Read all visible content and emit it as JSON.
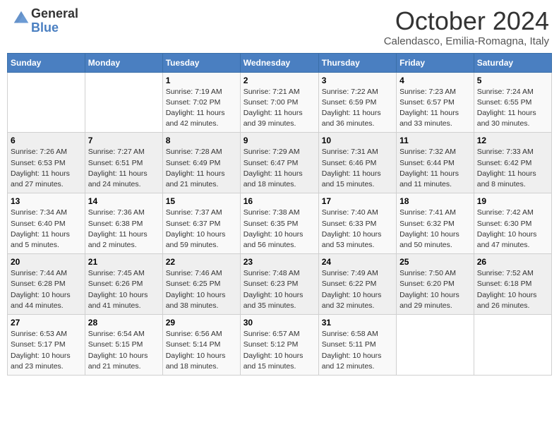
{
  "logo": {
    "general": "General",
    "blue": "Blue"
  },
  "title": "October 2024",
  "subtitle": "Calendasco, Emilia-Romagna, Italy",
  "weekdays": [
    "Sunday",
    "Monday",
    "Tuesday",
    "Wednesday",
    "Thursday",
    "Friday",
    "Saturday"
  ],
  "weeks": [
    [
      {
        "day": null,
        "info": null
      },
      {
        "day": null,
        "info": null
      },
      {
        "day": "1",
        "sunrise": "Sunrise: 7:19 AM",
        "sunset": "Sunset: 7:02 PM",
        "daylight": "Daylight: 11 hours and 42 minutes."
      },
      {
        "day": "2",
        "sunrise": "Sunrise: 7:21 AM",
        "sunset": "Sunset: 7:00 PM",
        "daylight": "Daylight: 11 hours and 39 minutes."
      },
      {
        "day": "3",
        "sunrise": "Sunrise: 7:22 AM",
        "sunset": "Sunset: 6:59 PM",
        "daylight": "Daylight: 11 hours and 36 minutes."
      },
      {
        "day": "4",
        "sunrise": "Sunrise: 7:23 AM",
        "sunset": "Sunset: 6:57 PM",
        "daylight": "Daylight: 11 hours and 33 minutes."
      },
      {
        "day": "5",
        "sunrise": "Sunrise: 7:24 AM",
        "sunset": "Sunset: 6:55 PM",
        "daylight": "Daylight: 11 hours and 30 minutes."
      }
    ],
    [
      {
        "day": "6",
        "sunrise": "Sunrise: 7:26 AM",
        "sunset": "Sunset: 6:53 PM",
        "daylight": "Daylight: 11 hours and 27 minutes."
      },
      {
        "day": "7",
        "sunrise": "Sunrise: 7:27 AM",
        "sunset": "Sunset: 6:51 PM",
        "daylight": "Daylight: 11 hours and 24 minutes."
      },
      {
        "day": "8",
        "sunrise": "Sunrise: 7:28 AM",
        "sunset": "Sunset: 6:49 PM",
        "daylight": "Daylight: 11 hours and 21 minutes."
      },
      {
        "day": "9",
        "sunrise": "Sunrise: 7:29 AM",
        "sunset": "Sunset: 6:47 PM",
        "daylight": "Daylight: 11 hours and 18 minutes."
      },
      {
        "day": "10",
        "sunrise": "Sunrise: 7:31 AM",
        "sunset": "Sunset: 6:46 PM",
        "daylight": "Daylight: 11 hours and 15 minutes."
      },
      {
        "day": "11",
        "sunrise": "Sunrise: 7:32 AM",
        "sunset": "Sunset: 6:44 PM",
        "daylight": "Daylight: 11 hours and 11 minutes."
      },
      {
        "day": "12",
        "sunrise": "Sunrise: 7:33 AM",
        "sunset": "Sunset: 6:42 PM",
        "daylight": "Daylight: 11 hours and 8 minutes."
      }
    ],
    [
      {
        "day": "13",
        "sunrise": "Sunrise: 7:34 AM",
        "sunset": "Sunset: 6:40 PM",
        "daylight": "Daylight: 11 hours and 5 minutes."
      },
      {
        "day": "14",
        "sunrise": "Sunrise: 7:36 AM",
        "sunset": "Sunset: 6:38 PM",
        "daylight": "Daylight: 11 hours and 2 minutes."
      },
      {
        "day": "15",
        "sunrise": "Sunrise: 7:37 AM",
        "sunset": "Sunset: 6:37 PM",
        "daylight": "Daylight: 10 hours and 59 minutes."
      },
      {
        "day": "16",
        "sunrise": "Sunrise: 7:38 AM",
        "sunset": "Sunset: 6:35 PM",
        "daylight": "Daylight: 10 hours and 56 minutes."
      },
      {
        "day": "17",
        "sunrise": "Sunrise: 7:40 AM",
        "sunset": "Sunset: 6:33 PM",
        "daylight": "Daylight: 10 hours and 53 minutes."
      },
      {
        "day": "18",
        "sunrise": "Sunrise: 7:41 AM",
        "sunset": "Sunset: 6:32 PM",
        "daylight": "Daylight: 10 hours and 50 minutes."
      },
      {
        "day": "19",
        "sunrise": "Sunrise: 7:42 AM",
        "sunset": "Sunset: 6:30 PM",
        "daylight": "Daylight: 10 hours and 47 minutes."
      }
    ],
    [
      {
        "day": "20",
        "sunrise": "Sunrise: 7:44 AM",
        "sunset": "Sunset: 6:28 PM",
        "daylight": "Daylight: 10 hours and 44 minutes."
      },
      {
        "day": "21",
        "sunrise": "Sunrise: 7:45 AM",
        "sunset": "Sunset: 6:26 PM",
        "daylight": "Daylight: 10 hours and 41 minutes."
      },
      {
        "day": "22",
        "sunrise": "Sunrise: 7:46 AM",
        "sunset": "Sunset: 6:25 PM",
        "daylight": "Daylight: 10 hours and 38 minutes."
      },
      {
        "day": "23",
        "sunrise": "Sunrise: 7:48 AM",
        "sunset": "Sunset: 6:23 PM",
        "daylight": "Daylight: 10 hours and 35 minutes."
      },
      {
        "day": "24",
        "sunrise": "Sunrise: 7:49 AM",
        "sunset": "Sunset: 6:22 PM",
        "daylight": "Daylight: 10 hours and 32 minutes."
      },
      {
        "day": "25",
        "sunrise": "Sunrise: 7:50 AM",
        "sunset": "Sunset: 6:20 PM",
        "daylight": "Daylight: 10 hours and 29 minutes."
      },
      {
        "day": "26",
        "sunrise": "Sunrise: 7:52 AM",
        "sunset": "Sunset: 6:18 PM",
        "daylight": "Daylight: 10 hours and 26 minutes."
      }
    ],
    [
      {
        "day": "27",
        "sunrise": "Sunrise: 6:53 AM",
        "sunset": "Sunset: 5:17 PM",
        "daylight": "Daylight: 10 hours and 23 minutes."
      },
      {
        "day": "28",
        "sunrise": "Sunrise: 6:54 AM",
        "sunset": "Sunset: 5:15 PM",
        "daylight": "Daylight: 10 hours and 21 minutes."
      },
      {
        "day": "29",
        "sunrise": "Sunrise: 6:56 AM",
        "sunset": "Sunset: 5:14 PM",
        "daylight": "Daylight: 10 hours and 18 minutes."
      },
      {
        "day": "30",
        "sunrise": "Sunrise: 6:57 AM",
        "sunset": "Sunset: 5:12 PM",
        "daylight": "Daylight: 10 hours and 15 minutes."
      },
      {
        "day": "31",
        "sunrise": "Sunrise: 6:58 AM",
        "sunset": "Sunset: 5:11 PM",
        "daylight": "Daylight: 10 hours and 12 minutes."
      },
      {
        "day": null,
        "info": null
      },
      {
        "day": null,
        "info": null
      }
    ]
  ]
}
